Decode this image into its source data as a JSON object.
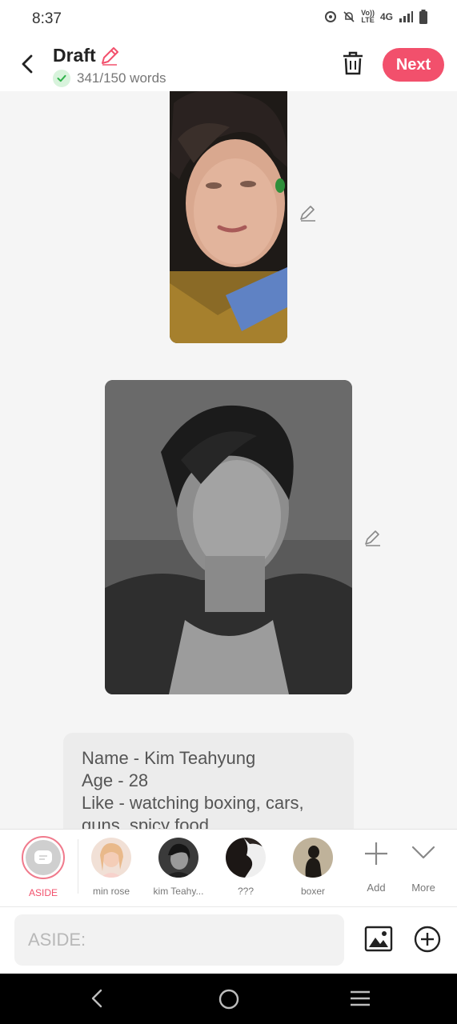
{
  "status_bar": {
    "time": "8:37",
    "network": "4G",
    "volte_top": "Vo))",
    "volte_bottom": "LTE"
  },
  "header": {
    "title": "Draft",
    "word_count": "341/150 words",
    "next_label": "Next"
  },
  "story": {
    "lines": [
      "Name - Kim Teahyung",
      "Age - 28",
      "Like - watching boxing, cars,",
      "guns, spicy food"
    ]
  },
  "characters": [
    {
      "label": "ASIDE",
      "selected": true
    },
    {
      "label": "min rose"
    },
    {
      "label": "kim Teahy..."
    },
    {
      "label": "???"
    },
    {
      "label": "boxer"
    }
  ],
  "tools": {
    "add_label": "Add",
    "more_label": "More"
  },
  "input": {
    "placeholder": "ASIDE:"
  },
  "colors": {
    "accent": "#f2506c",
    "aside_text": "#f2506c",
    "check_green": "#2fb24a"
  }
}
